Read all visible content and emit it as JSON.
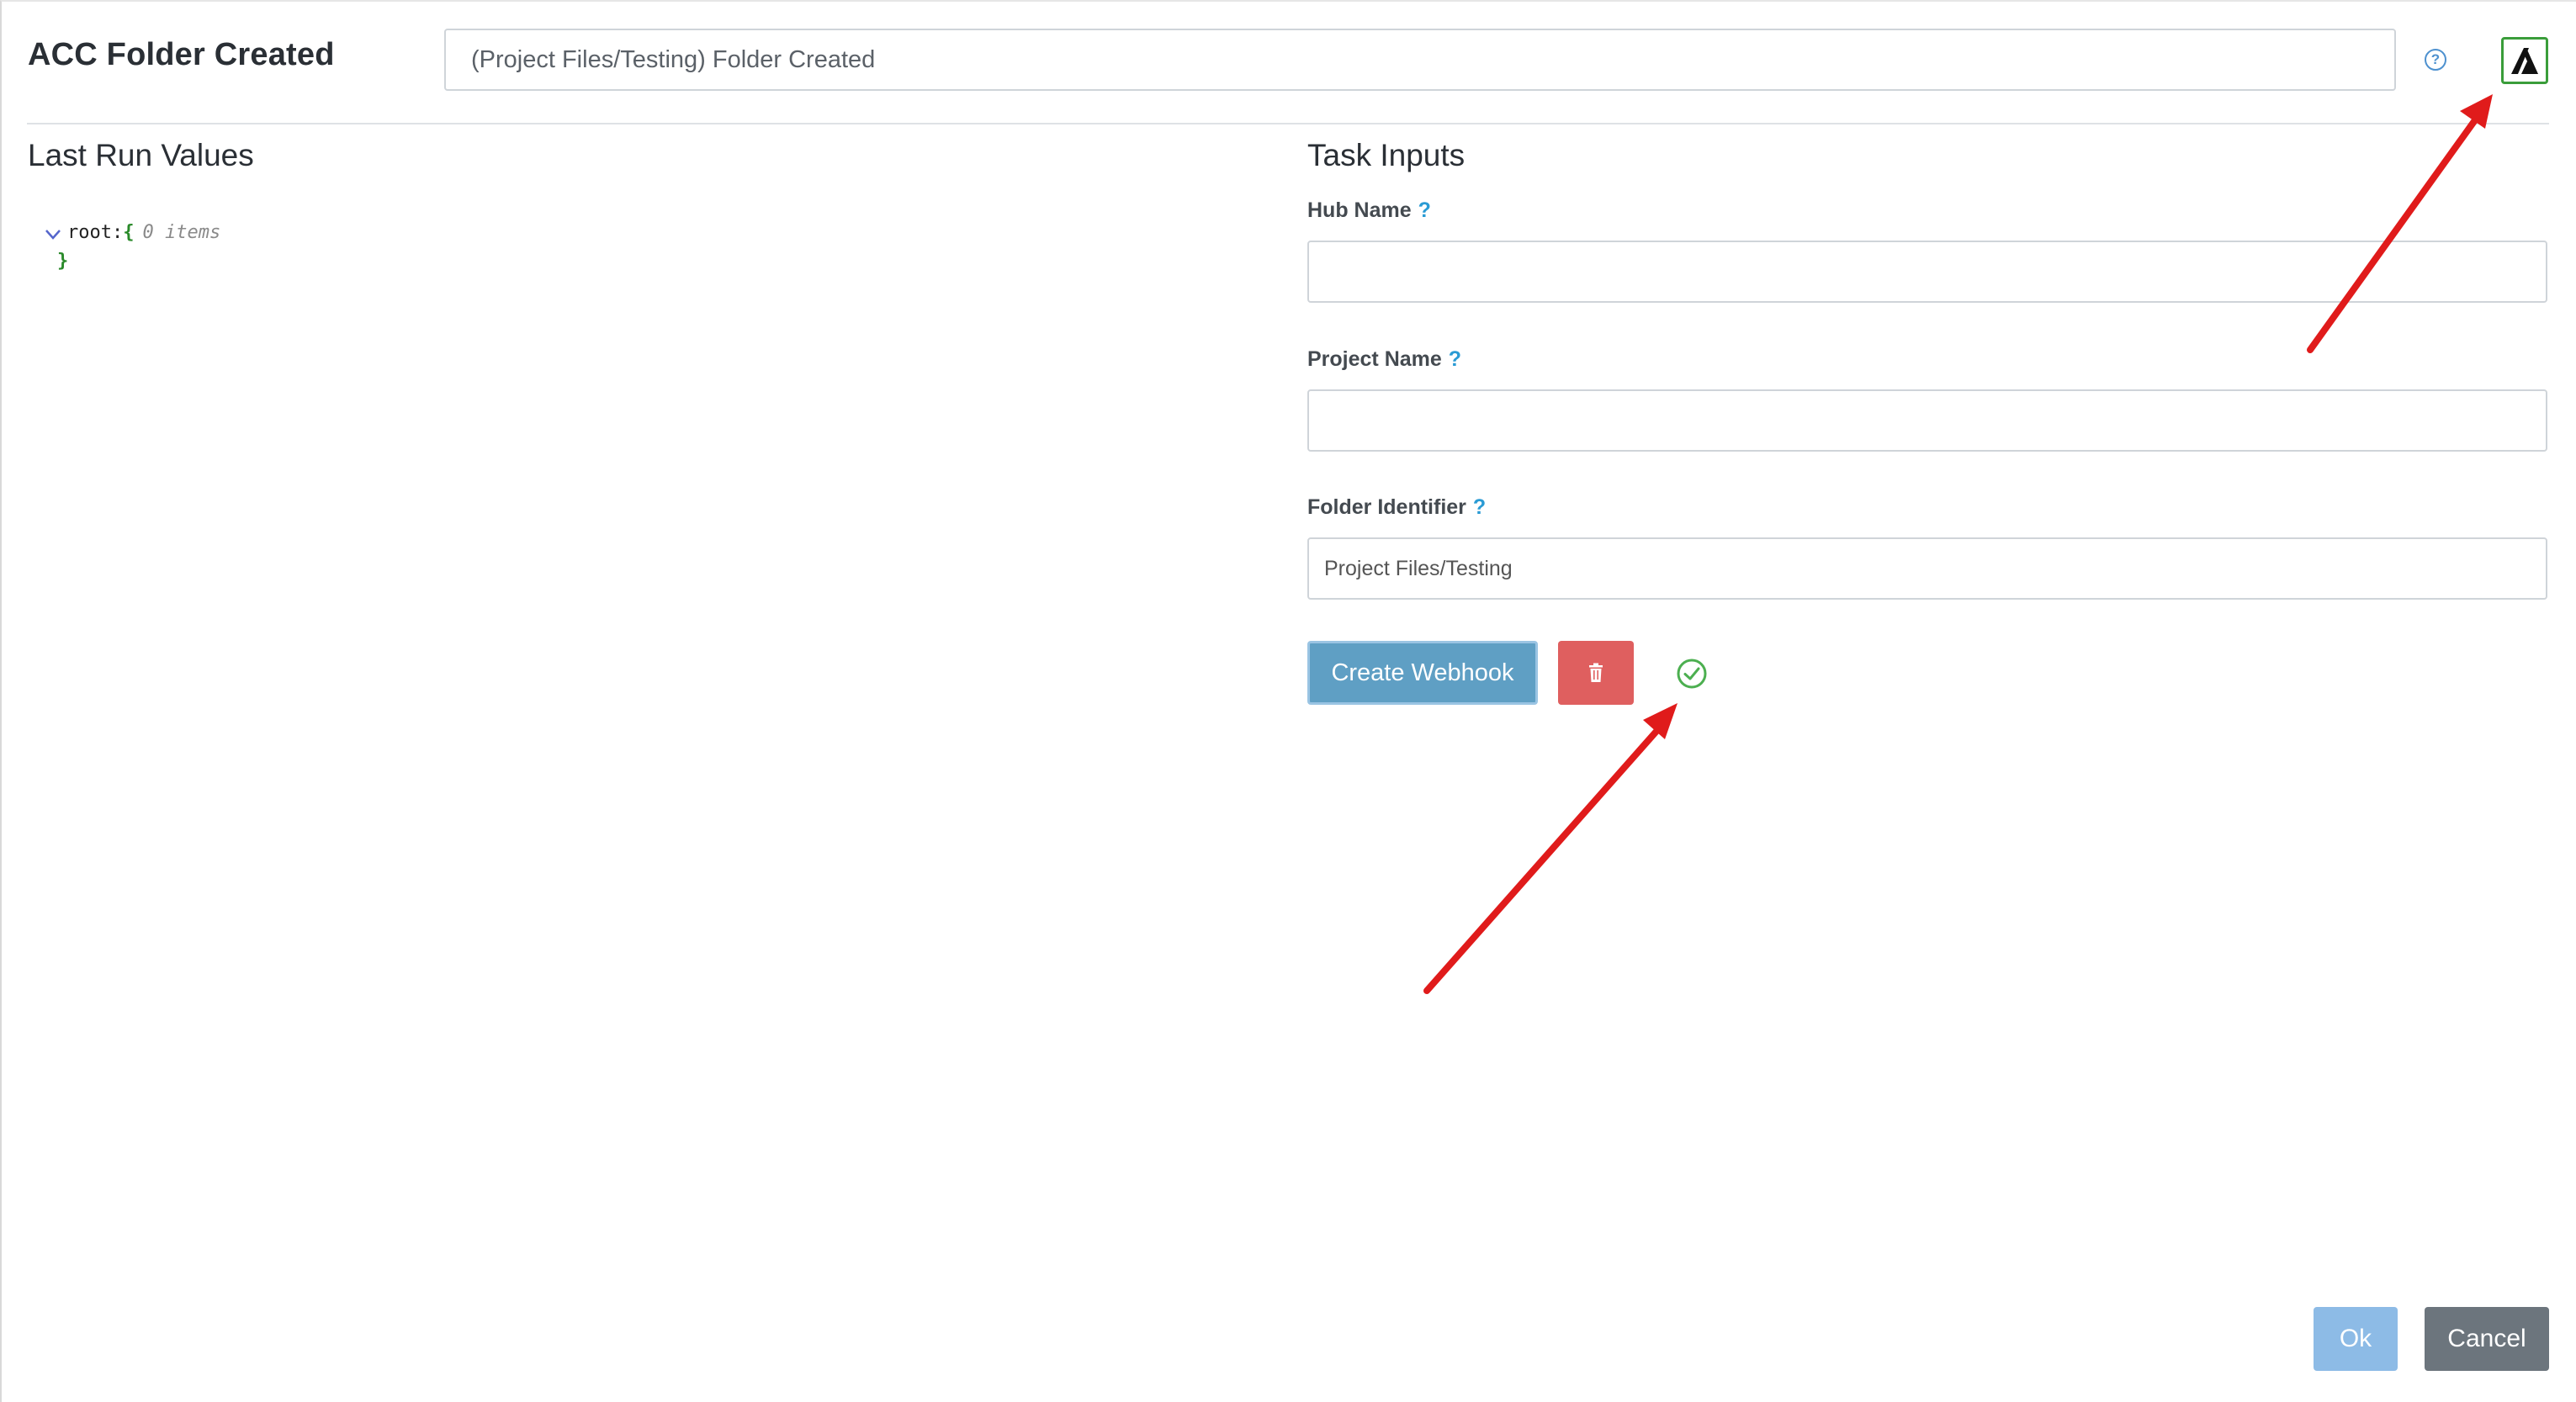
{
  "header": {
    "title": "ACC Folder Created",
    "name_value": "(Project Files/Testing) Folder Created",
    "help_icon": "help-circle-icon",
    "help_glyph": "?",
    "logo_icon": "autodesk-logo-icon"
  },
  "last_run": {
    "title": "Last Run Values",
    "tree": {
      "root_key": "root",
      "separator": ":",
      "open_brace": "{",
      "item_count": "0 items",
      "close_brace": "}"
    }
  },
  "task_inputs": {
    "title": "Task Inputs",
    "help_glyph": "?",
    "fields": [
      {
        "label": "Hub Name",
        "value": ""
      },
      {
        "label": "Project Name",
        "value": ""
      },
      {
        "label": "Folder Identifier",
        "value": "Project Files/Testing"
      }
    ],
    "create_webhook_label": "Create Webhook",
    "delete_icon": "trash-icon",
    "status_icon": "check-circle-icon"
  },
  "footer": {
    "ok_label": "Ok",
    "cancel_label": "Cancel"
  },
  "colors": {
    "create_webhook_bg": "#5f9fc4",
    "delete_bg": "#df5f5f",
    "status_green": "#4caf50",
    "logo_border": "#3a9d3a",
    "ok_bg": "#8dbbe6",
    "cancel_bg": "#6c757d",
    "annotation_arrow": "#e01b1b"
  }
}
